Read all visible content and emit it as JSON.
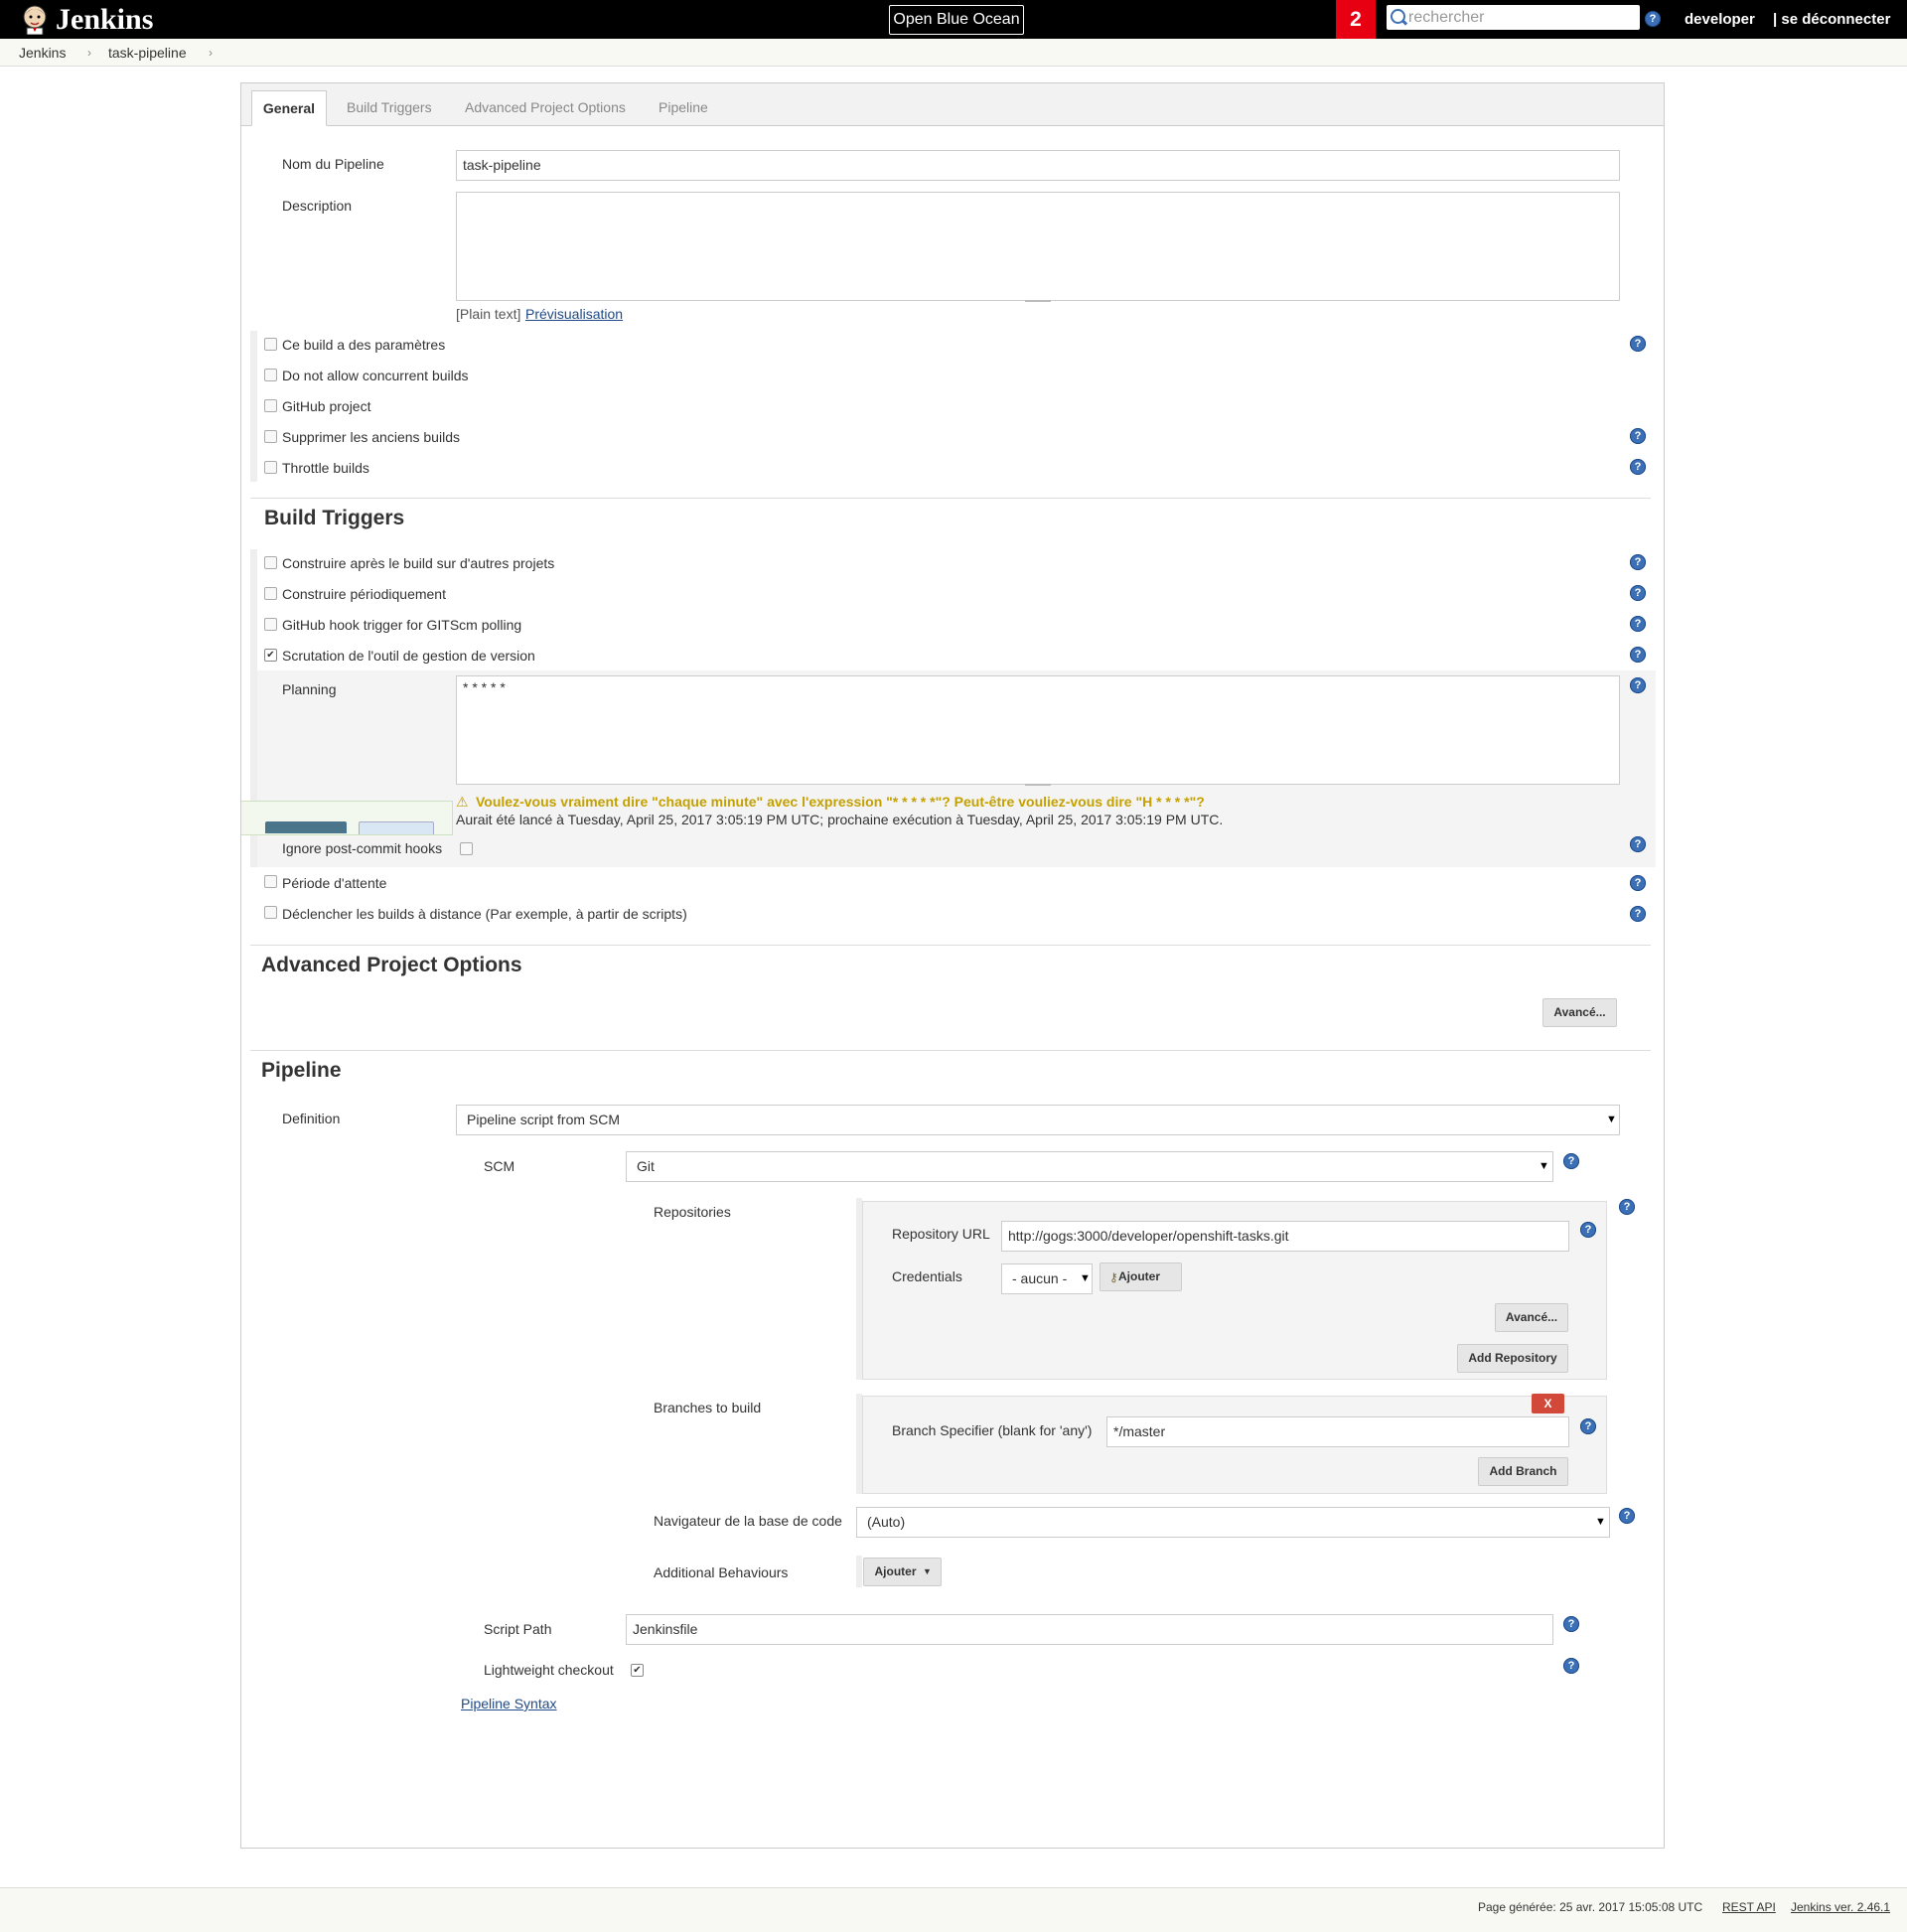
{
  "header": {
    "app_name": "Jenkins",
    "blue_ocean_label": "Open Blue Ocean",
    "notification_count": "2",
    "search_placeholder": "rechercher",
    "help_glyph": "?",
    "user": "developer",
    "logout": "| se déconnecter"
  },
  "breadcrumb": [
    "Jenkins",
    "task-pipeline"
  ],
  "tabs": [
    "General",
    "Build Triggers",
    "Advanced Project Options",
    "Pipeline"
  ],
  "general": {
    "name_label": "Nom du Pipeline",
    "name_value": "task-pipeline",
    "description_label": "Description",
    "plain_text": "[Plain text]",
    "preview_link": "Prévisualisation",
    "options": [
      {
        "label": "Ce build a des paramètres",
        "checked": false,
        "help": true
      },
      {
        "label": "Do not allow concurrent builds",
        "checked": false,
        "help": false
      },
      {
        "label": "GitHub project",
        "checked": false,
        "help": false
      },
      {
        "label": "Supprimer les anciens builds",
        "checked": false,
        "help": true
      },
      {
        "label": "Throttle builds",
        "checked": false,
        "help": true
      }
    ]
  },
  "build_triggers": {
    "title": "Build Triggers",
    "options": [
      {
        "label": "Construire après le build sur d'autres projets",
        "checked": false
      },
      {
        "label": "Construire périodiquement",
        "checked": false
      },
      {
        "label": "GitHub hook trigger for GITScm polling",
        "checked": false
      },
      {
        "label": "Scrutation de l'outil de gestion de version",
        "checked": true
      }
    ],
    "planning_label": "Planning",
    "planning_value": "* * * * *",
    "warning": "Voulez-vous vraiment dire \"chaque minute\" avec l'expression  \"* * * * *\"? Peut-être vouliez-vous dire \"H * * * *\"?",
    "schedule_info": "Aurait été lancé à Tuesday, April 25, 2017 3:05:19 PM UTC; prochaine exécution à Tuesday, April 25, 2017 3:05:19 PM UTC.",
    "ignore_hooks_label": "Ignore post-commit hooks",
    "more_options": [
      {
        "label": "Période d'attente",
        "checked": false
      },
      {
        "label": "Déclencher les builds à distance (Par exemple, à partir de scripts)",
        "checked": false
      }
    ]
  },
  "advanced": {
    "title": "Advanced Project Options",
    "button": "Avancé..."
  },
  "pipeline": {
    "title": "Pipeline",
    "definition_label": "Definition",
    "definition_value": "Pipeline script from SCM",
    "scm_label": "SCM",
    "scm_value": "Git",
    "repositories_label": "Repositories",
    "repo_url_label": "Repository URL",
    "repo_url_value": "http://gogs:3000/developer/openshift-tasks.git",
    "credentials_label": "Credentials",
    "credentials_value": "- aucun -",
    "add_credentials": "Ajouter",
    "repo_advanced": "Avancé...",
    "add_repository": "Add Repository",
    "branches_label": "Branches to build",
    "delete_branch": "X",
    "branch_spec_label": "Branch Specifier (blank for 'any')",
    "branch_spec_value": "*/master",
    "add_branch": "Add Branch",
    "browser_label": "Navigateur de la base de code",
    "browser_value": "(Auto)",
    "behaviours_label": "Additional Behaviours",
    "behaviours_button": "Ajouter",
    "script_path_label": "Script Path",
    "script_path_value": "Jenkinsfile",
    "lightweight_label": "Lightweight checkout",
    "syntax_link": "Pipeline Syntax"
  },
  "footer": {
    "generated": "Page générée: 25 avr. 2017 15:05:08 UTC",
    "rest_api": "REST API",
    "version": "Jenkins ver. 2.46.1"
  }
}
